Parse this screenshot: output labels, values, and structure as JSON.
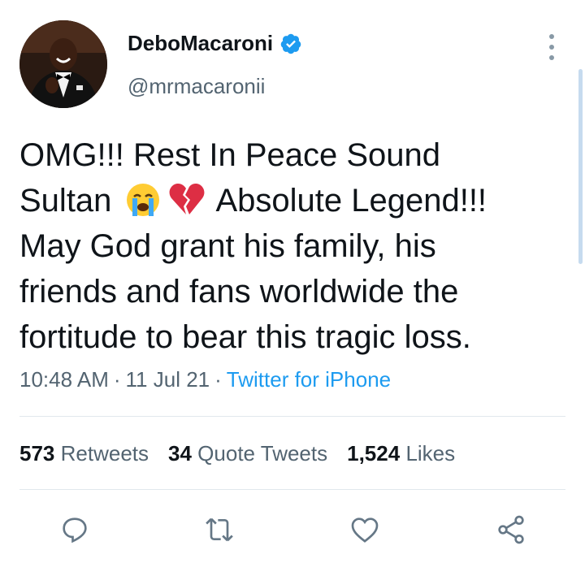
{
  "user": {
    "display_name": "DeboMacaroni",
    "handle": "@mrmacaronii",
    "verified_icon": "verified-badge-icon"
  },
  "tweet": {
    "line1": "OMG!!! Rest In Peace Sound",
    "line2_start": "Sultan",
    "line2_end": "Absolute Legend!!!",
    "line3": "May God grant his family, his",
    "line4": "friends and fans worldwide the",
    "line5": "fortitude to bear this tragic loss.",
    "emojis": [
      "loudly-crying-face-emoji",
      "broken-heart-emoji"
    ]
  },
  "meta": {
    "time": "10:48 AM",
    "separator": "·",
    "date": "11 Jul 21",
    "source": "Twitter for iPhone"
  },
  "stats": {
    "retweets_count": "573",
    "retweets_label": "Retweets",
    "quotes_count": "34",
    "quotes_label": "Quote Tweets",
    "likes_count": "1,524",
    "likes_label": "Likes"
  },
  "actions": [
    "reply-icon",
    "retweet-icon",
    "like-icon",
    "share-icon"
  ],
  "colors": {
    "link": "#1d9bf0",
    "secondary_text": "#536471",
    "primary_text": "#0f1419",
    "icon": "#657786",
    "verified": "#1d9bf0"
  }
}
